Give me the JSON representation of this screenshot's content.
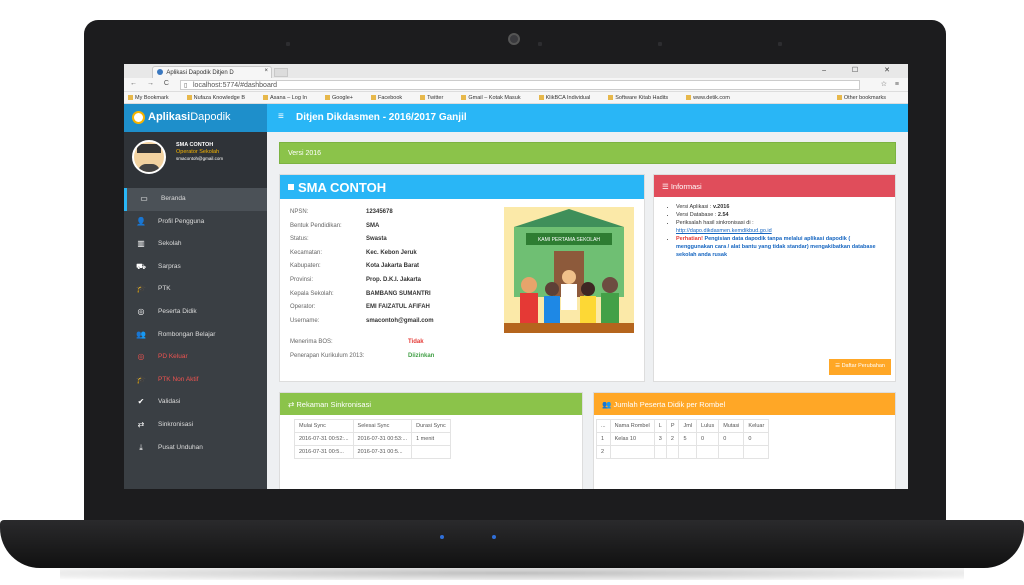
{
  "browser": {
    "tab_title": "Aplikasi Dapodik Ditjen D",
    "tab_close": "×",
    "window_controls": "– ☐ ✕",
    "nav_icons": "← → C",
    "url": "localhost:5774/#dashboard",
    "bookmarks": [
      "My Bookmark",
      "Nufaza Knowledge B",
      "Asana – Log In",
      "Google+",
      "Facebook",
      "Twitter",
      "Gmail – Kotak Masuk",
      "KlikBCA Individual",
      "Software Kitab Hadits",
      "www.detik.com"
    ],
    "other_bookmarks": "Other bookmarks"
  },
  "app": {
    "brand_bold": "Aplikasi",
    "brand_light": "Dapodik",
    "header_title": "Ditjen Dikdasmen - 2016/2017 Ganjil",
    "menu_icon": "≡"
  },
  "profile": {
    "name": "SMA CONTOH",
    "role": "Operator Sekolah",
    "email": "smacontoh@gmail.com"
  },
  "sidebar": {
    "items": [
      {
        "label": "Beranda",
        "icon": "monitor-icon",
        "glyph": "▭"
      },
      {
        "label": "Profil Pengguna",
        "icon": "user-icon",
        "glyph": "👤"
      },
      {
        "label": "Sekolah",
        "icon": "building-icon",
        "glyph": "▥"
      },
      {
        "label": "Sarpras",
        "icon": "car-icon",
        "glyph": "⛟"
      },
      {
        "label": "PTK",
        "icon": "graduation-icon",
        "glyph": "🎓"
      },
      {
        "label": "Peserta Didik",
        "icon": "circle-user-icon",
        "glyph": "◎"
      },
      {
        "label": "Rombongan Belajar",
        "icon": "group-icon",
        "glyph": "👥"
      },
      {
        "label": "PD Keluar",
        "icon": "circle-user-out-icon",
        "glyph": "◎"
      },
      {
        "label": "PTK Non Aktif",
        "icon": "graduation-off-icon",
        "glyph": "🎓"
      },
      {
        "label": "Validasi",
        "icon": "check-icon",
        "glyph": "✔"
      },
      {
        "label": "Sinkronisasi",
        "icon": "exchange-icon",
        "glyph": "⇄"
      },
      {
        "label": "Pusat Unduhan",
        "icon": "download-icon",
        "glyph": "⤓"
      }
    ]
  },
  "version_bar": "Versi 2016",
  "school": {
    "title": "SMA CONTOH",
    "fields": [
      {
        "label": "NPSN:",
        "value": "12345678"
      },
      {
        "label": "Bentuk Pendidikan:",
        "value": "SMA"
      },
      {
        "label": "Status:",
        "value": "Swasta"
      },
      {
        "label": "Kecamatan:",
        "value": "Kec. Kebon Jeruk"
      },
      {
        "label": "Kabupaten:",
        "value": "Kota Jakarta Barat"
      },
      {
        "label": "Provinsi:",
        "value": "Prop. D.K.I. Jakarta"
      },
      {
        "label": "Kepala Sekolah:",
        "value": "BAMBANG SUMANTRI"
      },
      {
        "label": "Operator:",
        "value": "EMI FAIZATUL AFIFAH"
      },
      {
        "label": "Username:",
        "value": "smacontoh@gmail.com"
      }
    ],
    "bos_label": "Menerima BOS:",
    "bos_value": "Tidak",
    "kurikulum_label": "Penerapan Kurikulum 2013:",
    "kurikulum_value": "Diizinkan",
    "illustration_sign": "KAMI PERTAMA SEKOLAH"
  },
  "informasi": {
    "title": "Informasi",
    "versi_aplikasi_label": "Versi Aplikasi : ",
    "versi_aplikasi_value": "v.2016",
    "versi_database_label": "Versi Database : ",
    "versi_database_value": "2.54",
    "periksalah": "Periksalah hasil sinkronisasi di :",
    "link": "http://dapo.dikdasmen.kemdikbud.go.id",
    "alert_label": "Perhatian!",
    "alert_body": "Pengisian data dapodik tanpa melalui aplikasi dapodik ( menggunakan cara / alat bantu yang tidak standar) mengakibatkan database sekolah anda rusak",
    "changes_button": "Daftar Perubahan"
  },
  "sync": {
    "title": "Rekaman Sinkronisasi",
    "headers": [
      "Mulai Sync",
      "Selesai Sync",
      "Durasi Sync"
    ],
    "rows": [
      [
        "2016-07-31 00:52:...",
        "2016-07-31 00:53:...",
        "1 menit"
      ],
      [
        "2016-07-31 00:5...",
        "2016-07-31 00:5...",
        ""
      ]
    ]
  },
  "rombel": {
    "title": "Jumlah Peserta Didik per Rombel",
    "headers": [
      "...",
      "Nama Rombel",
      "L",
      "P",
      "Jml",
      "Lulus",
      "Mutasi",
      "Keluar"
    ],
    "rows": [
      [
        "1",
        "Kelas 10",
        "3",
        "2",
        "5",
        "0",
        "0",
        "0"
      ],
      [
        "2",
        "",
        "",
        "",
        "",
        "",
        "",
        ""
      ]
    ]
  },
  "colors": {
    "topbar": "#29b6f6",
    "sidebar": "#3a3f44",
    "version_bar": "#8bc34a",
    "info_header": "#e04d5b",
    "rombel_header": "#ffa726"
  }
}
